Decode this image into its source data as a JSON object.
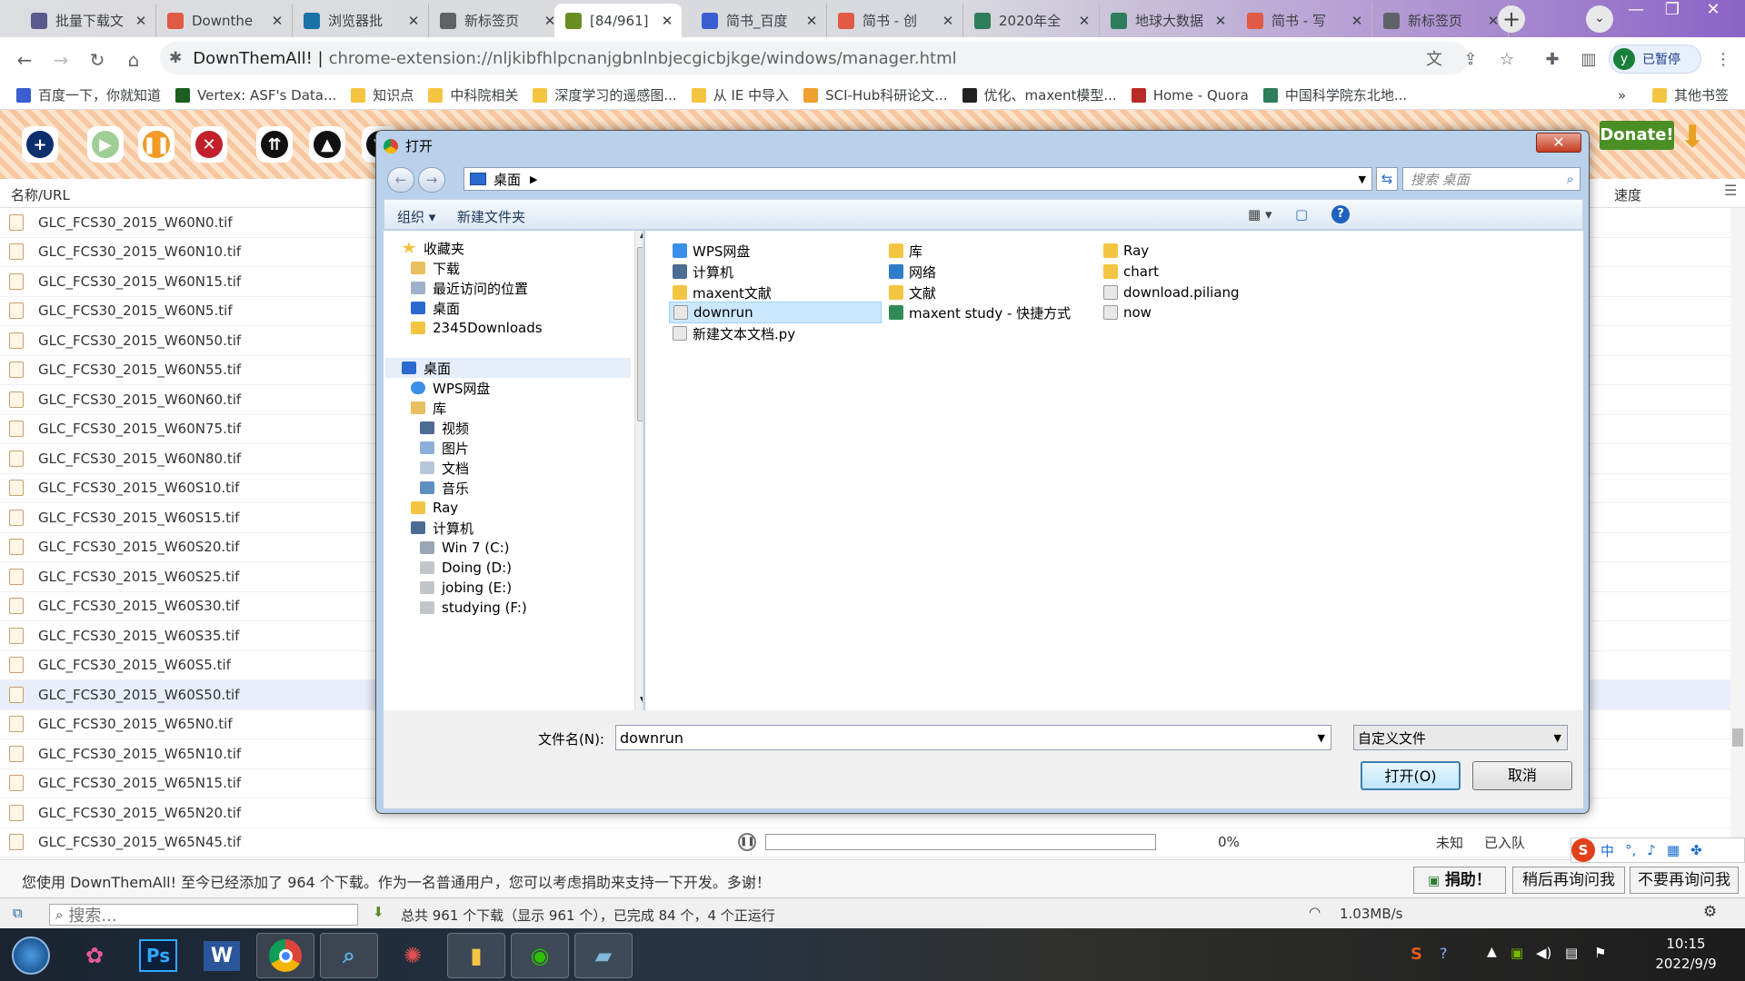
{
  "browser": {
    "tabs": [
      {
        "label": "批量下载文",
        "icon": "download-page-icon",
        "color": "#5a5a8c"
      },
      {
        "label": "Downthe",
        "icon": "jianshu-icon",
        "color": "#e05a45"
      },
      {
        "label": "浏览器批",
        "icon": "zhihu-icon",
        "color": "#1a73a8"
      },
      {
        "label": "新标签页",
        "icon": "chrome-icon",
        "color": "#5f6368"
      },
      {
        "label": "[84/961]",
        "icon": "downthemall-icon",
        "color": "#6b8e23"
      },
      {
        "label": "简书_百度",
        "icon": "baidu-paw-icon",
        "color": "#3a5ecf"
      },
      {
        "label": "简书 - 创",
        "icon": "jianshu-icon",
        "color": "#e05a45"
      },
      {
        "label": "2020年全",
        "icon": "globe-icon",
        "color": "#2e7d5b"
      },
      {
        "label": "地球大数据",
        "icon": "globe-icon",
        "color": "#2e7d5b"
      },
      {
        "label": "简书 - 写",
        "icon": "jianshu-icon",
        "color": "#e05a45"
      },
      {
        "label": "新标签页",
        "icon": "chrome-icon",
        "color": "#5f6368"
      }
    ],
    "active_tab_index": 4,
    "omnibox": {
      "ext_name": "DownThemAll! |",
      "url": "chrome-extension://nljkibfhlpcnanjgbnlnbjecgicbjkge/windows/manager.html"
    },
    "profile": {
      "initial": "y",
      "status": "已暂停"
    },
    "bookmarks": [
      {
        "label": "百度一下，你就知道",
        "icon": "baidu-paw-icon",
        "color": "#3a5ecf"
      },
      {
        "label": "Vertex: ASF's Data...",
        "icon": "asf-icon",
        "color": "#1b5e20"
      },
      {
        "label": "知识点",
        "icon": "folder-icon",
        "color": "#f4c542"
      },
      {
        "label": "中科院相关",
        "icon": "folder-icon",
        "color": "#f4c542"
      },
      {
        "label": "深度学习的遥感图...",
        "icon": "folder-icon",
        "color": "#f4c542"
      },
      {
        "label": "从 IE 中导入",
        "icon": "folder-icon",
        "color": "#f4c542"
      },
      {
        "label": "SCI-Hub科研论文...",
        "icon": "scihub-icon",
        "color": "#f0a030"
      },
      {
        "label": "优化、maxent模型...",
        "icon": "github-icon",
        "color": "#222222"
      },
      {
        "label": "Home - Quora",
        "icon": "quora-icon",
        "color": "#b92b27"
      },
      {
        "label": "中国科学院东北地...",
        "icon": "globe-icon",
        "color": "#2e7d5b"
      }
    ],
    "other_bookmarks": "其他书签"
  },
  "dta": {
    "donate_label": "Donate!",
    "col_name": "名称/URL",
    "col_speed": "速度",
    "rows": [
      {
        "name": "GLC_FCS30_2015_W60N0.tif"
      },
      {
        "name": "GLC_FCS30_2015_W60N10.tif"
      },
      {
        "name": "GLC_FCS30_2015_W60N15.tif"
      },
      {
        "name": "GLC_FCS30_2015_W60N5.tif"
      },
      {
        "name": "GLC_FCS30_2015_W60N50.tif"
      },
      {
        "name": "GLC_FCS30_2015_W60N55.tif"
      },
      {
        "name": "GLC_FCS30_2015_W60N60.tif"
      },
      {
        "name": "GLC_FCS30_2015_W60N75.tif"
      },
      {
        "name": "GLC_FCS30_2015_W60N80.tif"
      },
      {
        "name": "GLC_FCS30_2015_W60S10.tif"
      },
      {
        "name": "GLC_FCS30_2015_W60S15.tif"
      },
      {
        "name": "GLC_FCS30_2015_W60S20.tif"
      },
      {
        "name": "GLC_FCS30_2015_W60S25.tif"
      },
      {
        "name": "GLC_FCS30_2015_W60S30.tif"
      },
      {
        "name": "GLC_FCS30_2015_W60S35.tif"
      },
      {
        "name": "GLC_FCS30_2015_W60S5.tif"
      },
      {
        "name": "GLC_FCS30_2015_W60S50.tif"
      },
      {
        "name": "GLC_FCS30_2015_W65N0.tif"
      },
      {
        "name": "GLC_FCS30_2015_W65N10.tif"
      },
      {
        "name": "GLC_FCS30_2015_W65N15.tif"
      },
      {
        "name": "GLC_FCS30_2015_W65N20.tif"
      },
      {
        "name": "GLC_FCS30_2015_W65N45.tif",
        "percent": "0%",
        "eta": "未知",
        "status": "已入队"
      }
    ],
    "selected_row_index": 16,
    "notice": "您使用 DownThemAll! 至今已经添加了 964 个下载。作为一名普通用户，您可以考虑捐助来支持一下开发。多谢！",
    "notice_buttons": {
      "donate": "捐助！",
      "later": "稍后再询问我",
      "never": "不要再询问我"
    },
    "search_placeholder": "搜索...",
    "status_summary": "总共 961 个下载（显示 961 个），已完成 84 个，4 个正运行",
    "speed": "1.03MB/s"
  },
  "dialog": {
    "title": "打开",
    "breadcrumb": "桌面",
    "search_placeholder": "搜索 桌面",
    "organize": "组织",
    "new_folder": "新建文件夹",
    "nav": {
      "favorites": "收藏夹",
      "downloads": "下载",
      "recent": "最近访问的位置",
      "desktop_fav": "桌面",
      "downloads2345": "2345Downloads",
      "desktop": "桌面",
      "wps": "WPS网盘",
      "library": "库",
      "video": "视频",
      "pictures": "图片",
      "documents": "文档",
      "music": "音乐",
      "ray": "Ray",
      "computer": "计算机",
      "drive_c": "Win 7 (C:)",
      "drive_d": "Doing (D:)",
      "drive_e": "jobing (E:)",
      "drive_f": "studying (F:)"
    },
    "files": [
      {
        "name": "WPS网盘",
        "icon": "cloud-icon"
      },
      {
        "name": "计算机",
        "icon": "computer-icon"
      },
      {
        "name": "maxent文献",
        "icon": "folder-icon"
      },
      {
        "name": "downrun",
        "icon": "file-icon"
      },
      {
        "name": "新建文本文档.py",
        "icon": "file-icon"
      },
      {
        "name": "库",
        "icon": "folder-icon"
      },
      {
        "name": "网络",
        "icon": "network-icon"
      },
      {
        "name": "文献",
        "icon": "folder-icon"
      },
      {
        "name": "maxent study - 快捷方式",
        "icon": "shortcut-icon"
      },
      {
        "name": "Ray",
        "icon": "folder-icon"
      },
      {
        "name": "chart",
        "icon": "folder-icon"
      },
      {
        "name": "download.piliang",
        "icon": "file-icon"
      },
      {
        "name": "now",
        "icon": "file-icon"
      }
    ],
    "filename_label": "文件名(N):",
    "filename_value": "downrun",
    "filetype_value": "自定义文件",
    "open_button": "打开(O)",
    "cancel_button": "取消"
  },
  "taskbar": {
    "clock_time": "10:15",
    "clock_date": "2022/9/9",
    "ime": "中"
  }
}
